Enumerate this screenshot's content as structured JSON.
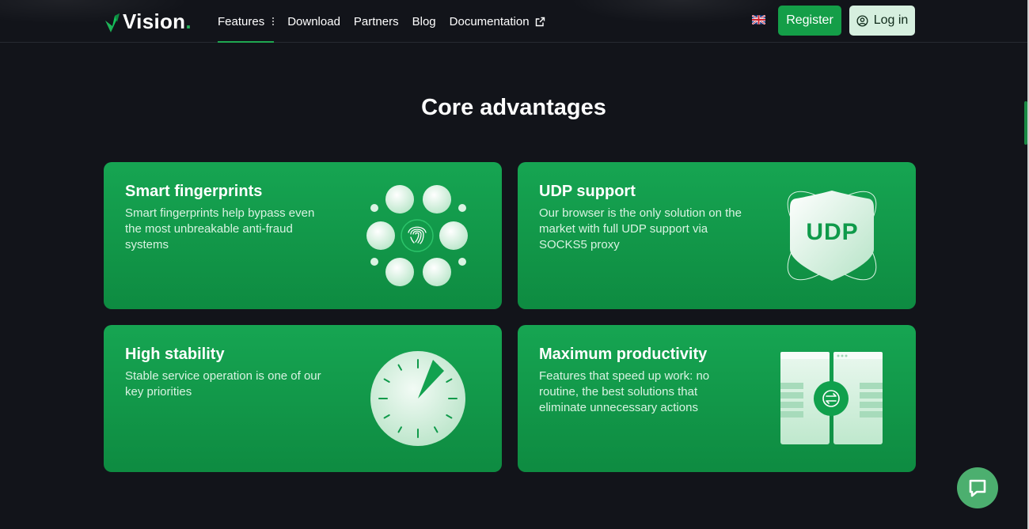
{
  "header": {
    "logo_text": "Vision",
    "nav": [
      {
        "label": "Features"
      },
      {
        "label": "Download"
      },
      {
        "label": "Partners"
      },
      {
        "label": "Blog"
      },
      {
        "label": "Documentation"
      }
    ],
    "register_label": "Register",
    "login_label": "Log in"
  },
  "main": {
    "title": "Core advantages",
    "cards": [
      {
        "title": "Smart fingerprints",
        "description": "Smart fingerprints help bypass even the most unbreakable anti-fraud systems"
      },
      {
        "title": "UDP support",
        "description": "Our browser is the only solution on the market with full UDP support via SOCKS5 proxy",
        "badge_text": "UDP"
      },
      {
        "title": "High stability",
        "description": "Stable service operation is one of our key priorities"
      },
      {
        "title": "Maximum productivity",
        "description": "Features that speed up work: no routine, the best solutions that eliminate unnecessary actions"
      }
    ]
  },
  "colors": {
    "background": "#12141a",
    "accent": "#149e48",
    "card_top": "#16a552",
    "card_bottom": "#0e8b41",
    "login_bg": "#d6efdf"
  },
  "icons": [
    "vision-logo-icon",
    "kebab-menu-icon",
    "external-link-icon",
    "uk-flag-icon",
    "user-circle-icon",
    "fingerprint-icon",
    "udp-shield-icon",
    "clock-dial-icon",
    "sync-windows-icon",
    "chat-bubble-icon"
  ]
}
